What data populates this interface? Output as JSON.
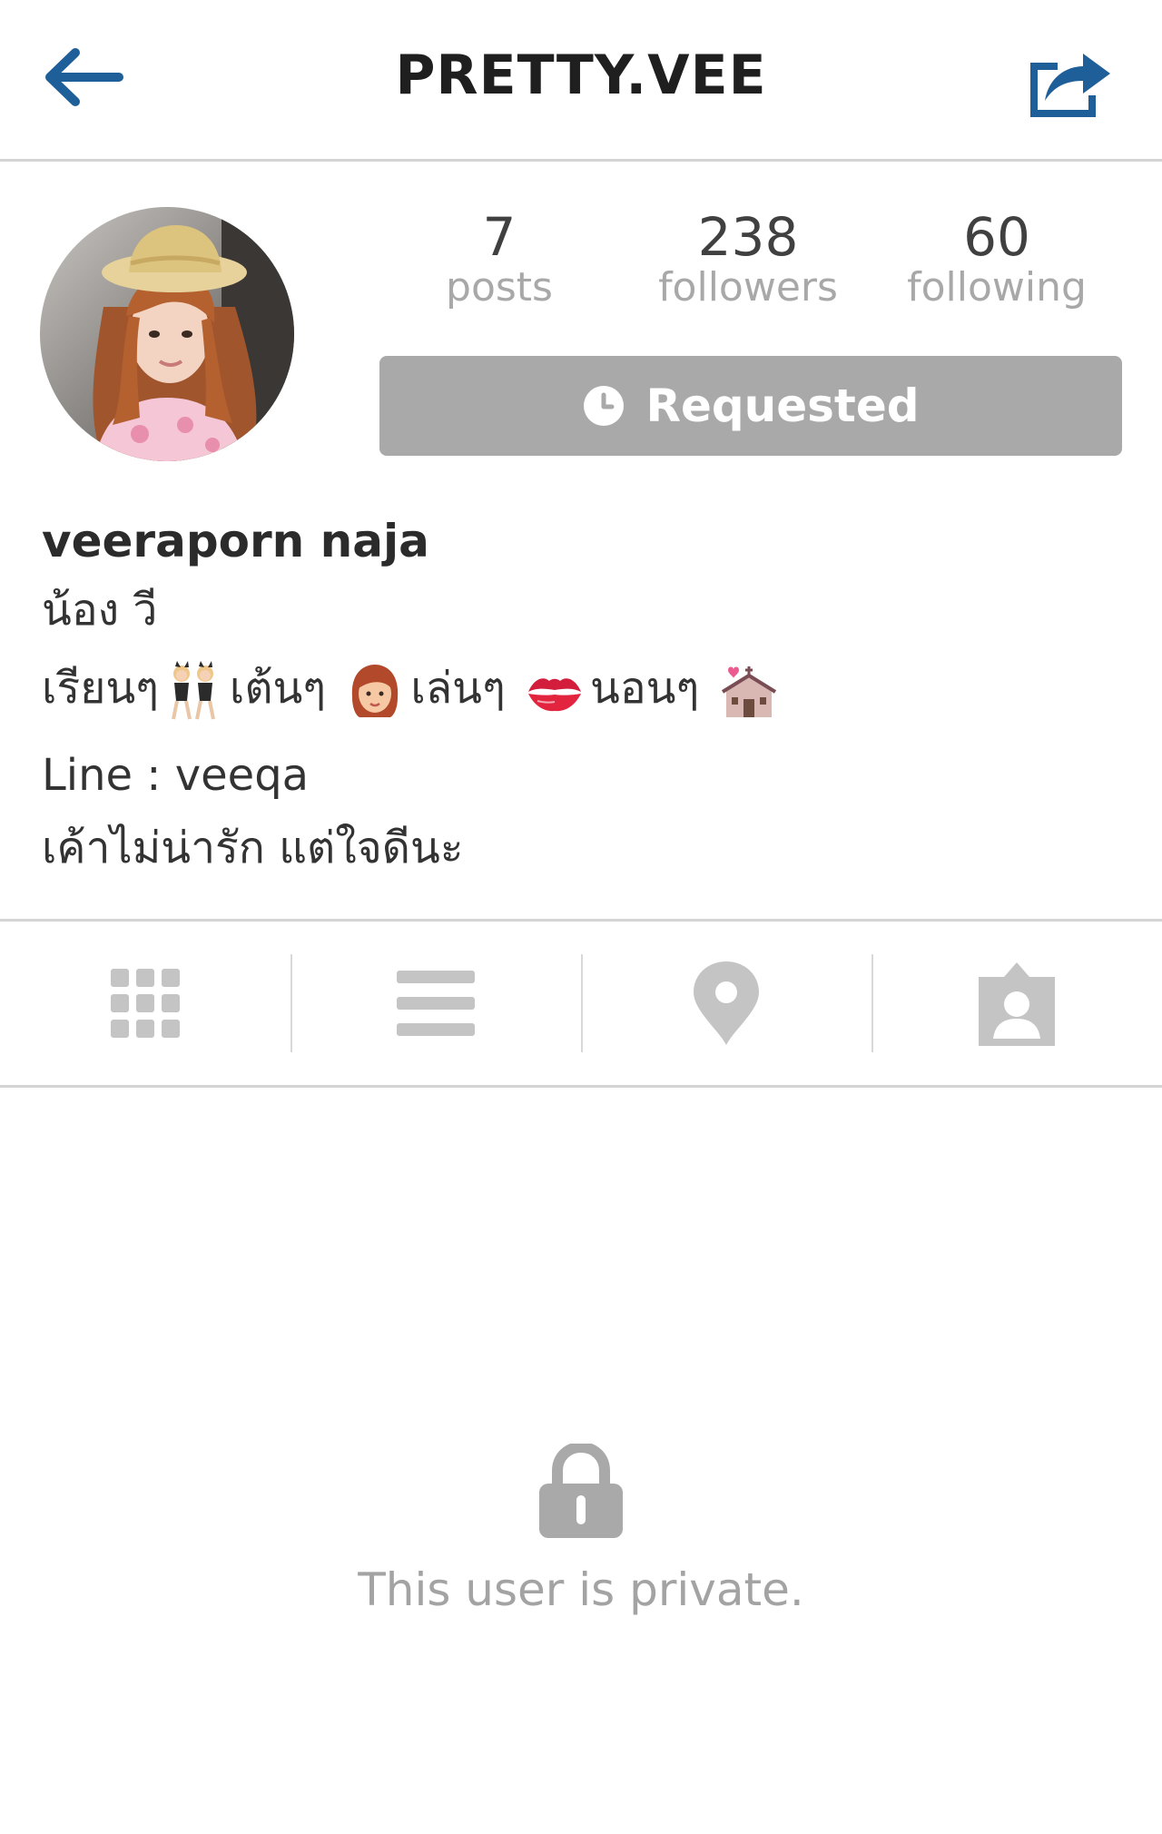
{
  "header": {
    "title": "PRETTY.VEE",
    "back_icon": "arrow-left-icon",
    "share_icon": "share-icon",
    "accent_color": "#1f5f99"
  },
  "profile": {
    "stats": [
      {
        "value": "7",
        "label": "posts"
      },
      {
        "value": "238",
        "label": "followers"
      },
      {
        "value": "60",
        "label": "following"
      }
    ],
    "follow_button": {
      "label": "Requested",
      "icon": "clock-icon",
      "color": "#a9a9a9"
    }
  },
  "bio": {
    "name": "veeraporn naja",
    "line1": "น้อง วี",
    "line2": {
      "part1": "เรียนๆ",
      "emoji1": "dancers-emoji",
      "part2": "เต้นๆ",
      "emoji2": "woman-emoji",
      "part3": "เล่นๆ",
      "emoji3": "kiss-mark-emoji",
      "part4": "นอนๆ",
      "emoji4": "wedding-chapel-emoji"
    },
    "line3": "Line : veeqa",
    "line4": "เค้าไม่น่ารัก แต่ใจดีนะ"
  },
  "tabs": [
    {
      "name": "grid",
      "icon": "grid-icon"
    },
    {
      "name": "list",
      "icon": "list-icon"
    },
    {
      "name": "map",
      "icon": "location-pin-icon"
    },
    {
      "name": "tagged",
      "icon": "tagged-person-icon"
    }
  ],
  "private_notice": {
    "icon": "lock-icon",
    "text": "This user is private."
  }
}
